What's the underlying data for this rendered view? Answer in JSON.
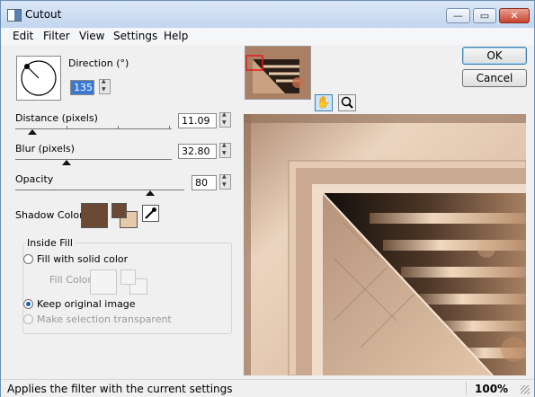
{
  "window": {
    "title": "Cutout",
    "controls": {
      "minimize_icon": "minimize-icon",
      "maximize_icon": "maximize-icon",
      "close_icon": "close-icon"
    }
  },
  "menu": [
    "Edit",
    "Filter",
    "View",
    "Settings",
    "Help"
  ],
  "direction": {
    "label": "Direction (°)",
    "value": "135"
  },
  "distance": {
    "label": "Distance (pixels)",
    "value": "11.09",
    "level": 0.11
  },
  "blur": {
    "label": "Blur (pixels)",
    "value": "32.80",
    "level": 0.33
  },
  "opacity": {
    "label": "Opacity",
    "value": "80",
    "level": 0.8
  },
  "shadow": {
    "label": "Shadow Color",
    "color": "#6b4a35",
    "fg_color": "#6b4a35",
    "bg_color": "#e6c9a9",
    "eyedropper_icon": "eyedropper-icon"
  },
  "inside_fill": {
    "title": "Inside Fill",
    "solid_label": "Fill with solid color",
    "fill_color_label": "Fill Color",
    "keep_label": "Keep original image",
    "transparent_label": "Make selection transparent",
    "selected": "keep_original"
  },
  "buttons": {
    "ok": "OK",
    "cancel": "Cancel"
  },
  "tools": {
    "hand_icon": "hand-icon",
    "zoom_icon": "zoom-icon"
  },
  "status": {
    "text": "Applies the filter with the current settings",
    "zoom": "100%"
  },
  "colors": {
    "accent": "#1d5ebf",
    "preview_bg": "#d4b397",
    "preview_dark": "#1e1712"
  }
}
